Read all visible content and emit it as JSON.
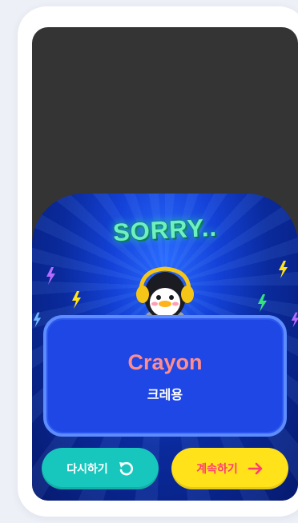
{
  "result": {
    "title": "SORRY..",
    "word_en": "Crayon",
    "word_ko": "크레용"
  },
  "buttons": {
    "retry_label": "다시하기",
    "continue_label": "계속하기"
  },
  "colors": {
    "page_bg": "#eef0f7",
    "screen_bg": "#343434",
    "panel_blue": "#1442d8",
    "answer_box": "#1f47e6",
    "title_green": "#6ff0c0",
    "word_pink": "#ff8d8d",
    "retry_teal": "#17c7bd",
    "continue_yellow": "#ffe21a",
    "continue_text": "#ff3d73"
  },
  "icons": {
    "retry": "rotate-left-icon",
    "continue": "arrow-right-icon",
    "decor": "lightning-bolt-icon",
    "character": "penguin-with-headphones"
  }
}
